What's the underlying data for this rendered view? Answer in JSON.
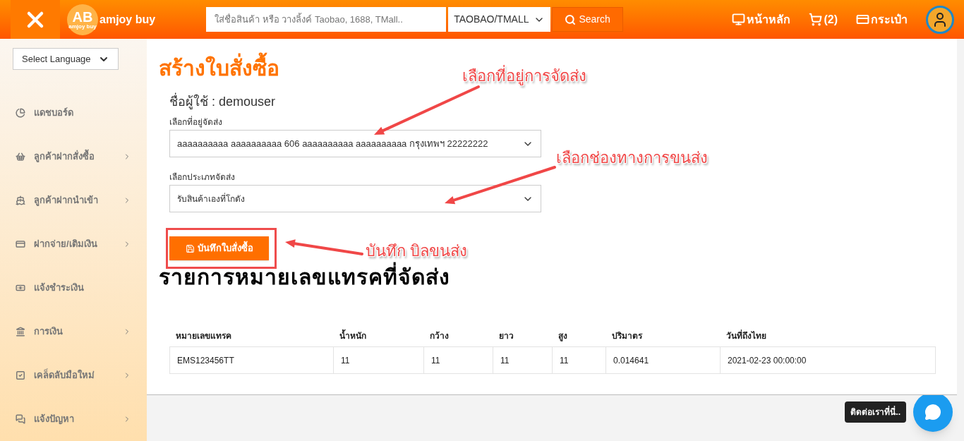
{
  "header": {
    "logo_mark": "AB",
    "logo_sub": "amjoy buy",
    "logo_name": "amjoy buy",
    "search": {
      "placeholder": "ใส่ชื่อสินค้า หรือ วางลิ้งค์ Taobao, 1688, TMall.."
    },
    "source": "TAOBAO/TMALL",
    "search_button": "Search",
    "nav": [
      {
        "kind": "home",
        "label": "หน้าหลัก"
      },
      {
        "kind": "cart",
        "label": "(2)"
      },
      {
        "kind": "wallet",
        "label": "กระเป๋า"
      }
    ]
  },
  "sidebar": {
    "language": "Select Language",
    "items": [
      {
        "label": "แดชบอร์ด",
        "has_children": false
      },
      {
        "label": "ลูกค้าฝากสั่งซื้อ",
        "has_children": true
      },
      {
        "label": "ลูกค้าฝากนำเข้า",
        "has_children": true
      },
      {
        "label": "ฝากจ่าย/เติมเงิน",
        "has_children": true
      },
      {
        "label": "แจ้งชำระเงิน",
        "has_children": false
      },
      {
        "label": "การเงิน",
        "has_children": true
      },
      {
        "label": "เคล็ดลับมือใหม่",
        "has_children": true
      },
      {
        "label": "แจ้งปัญหา",
        "has_children": true
      }
    ]
  },
  "page": {
    "title": "สร้างใบสั่งซื้อ",
    "user": "ชื่อผู้ใช้ : demouser",
    "address_label": "เลือกที่อยู่จัดส่ง",
    "address": "aaaaaaaaaa aaaaaaaaaa 606 aaaaaaaaaa aaaaaaaaaa กรุงเทพฯ 22222222",
    "shipping_label": "เลือกประเภทจัดส่ง",
    "shipping": "รับสินค้าเองที่โกดัง",
    "save_button": "บันทึกใบสั่งซื้อ",
    "tracking_title": "รายการหมายเลขแทรคที่จัดส่ง",
    "table": {
      "columns": [
        "หมายเลขแทรค",
        "น้ำหนัก",
        "กว้าง",
        "ยาว",
        "สูง",
        "ปริมาตร",
        "วันที่ถึงไทย"
      ],
      "rows": [
        [
          "EMS123456TT",
          "11",
          "11",
          "11",
          "11",
          "0.014641",
          "2021-02-23 00:00:00"
        ]
      ]
    }
  },
  "annotations": [
    "เลือกที่อยู่การจัดส่ง",
    "เลือกช่องทางการขนส่ง",
    "บันทึก บิลขนส่ง"
  ],
  "chat": {
    "tooltip": "ติดต่อเราที่นี่.."
  }
}
